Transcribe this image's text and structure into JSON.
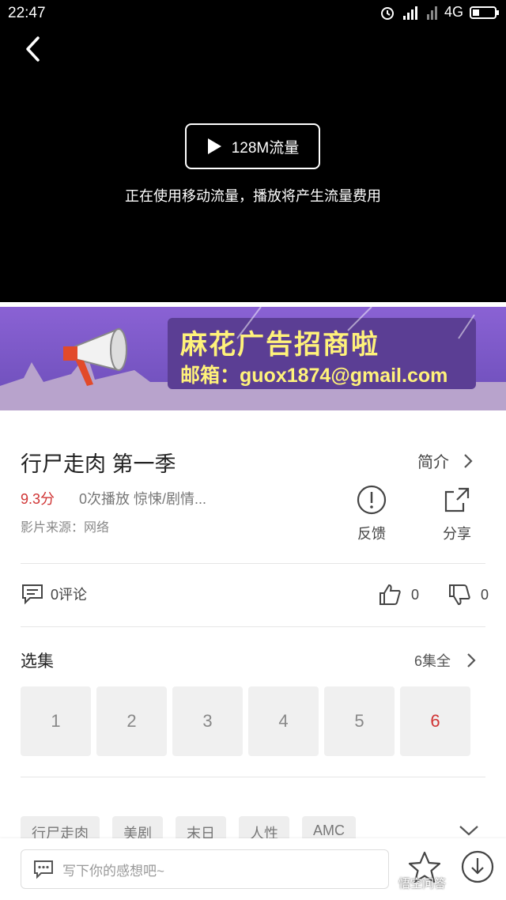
{
  "status_bar": {
    "time": "22:47",
    "network": "4G"
  },
  "video": {
    "play_label": "128M流量",
    "notice": "正在使用移动流量，播放将产生流量费用"
  },
  "ad": {
    "title": "麻花广告招商啦",
    "email": "邮箱：guox1874@gmail.com"
  },
  "info": {
    "title": "行尸走肉 第一季",
    "intro_label": "简介",
    "score": "9.3分",
    "meta": "0次播放 惊悚/剧情...",
    "source": "影片来源：网络",
    "feedback_label": "反馈",
    "share_label": "分享"
  },
  "social": {
    "comments": "0评论",
    "likes": "0",
    "dislikes": "0"
  },
  "episodes": {
    "title": "选集",
    "total": "6集全",
    "items": [
      "1",
      "2",
      "3",
      "4",
      "5",
      "6"
    ],
    "active": "6"
  },
  "tags": [
    "行尸走肉",
    "美剧",
    "末日",
    "人性",
    "AMC"
  ],
  "bottom": {
    "placeholder": "写下你的感想吧~",
    "watermark": "悟空问答"
  },
  "colors": {
    "accent": "#d03434",
    "ad_bg": "#7d5bc7",
    "ad_text": "#fff27a"
  }
}
